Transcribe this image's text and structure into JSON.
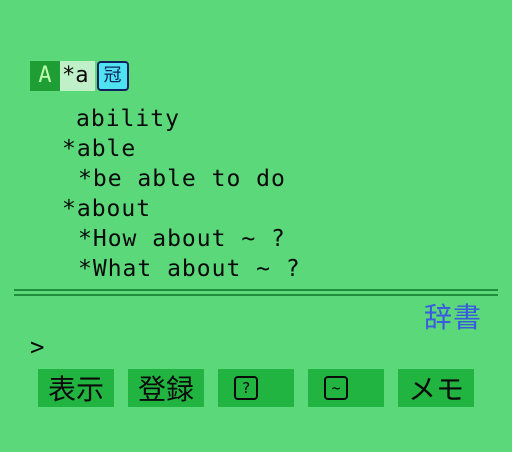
{
  "search": {
    "mode_badge": "A",
    "query": "*a",
    "kanji_badge": "冠"
  },
  "entries": [
    {
      "text": "ability"
    },
    {
      "text": "*able"
    },
    {
      "text": "*be able to do"
    },
    {
      "text": "*about"
    },
    {
      "text": "*How about ~ ?"
    },
    {
      "text": "*What about ~ ?"
    }
  ],
  "dictionary_label": "辞書",
  "prompt": ">",
  "function_keys": [
    {
      "label": "表示"
    },
    {
      "label": "登録"
    },
    {
      "label": "",
      "icon": "?"
    },
    {
      "label": "",
      "icon": "~"
    },
    {
      "label": "メモ"
    }
  ],
  "colors": {
    "background": "#5ad87a",
    "key_background": "#22b440",
    "dictionary_label": "#3a5ae0",
    "kanji_badge": "#4fe3f0"
  }
}
